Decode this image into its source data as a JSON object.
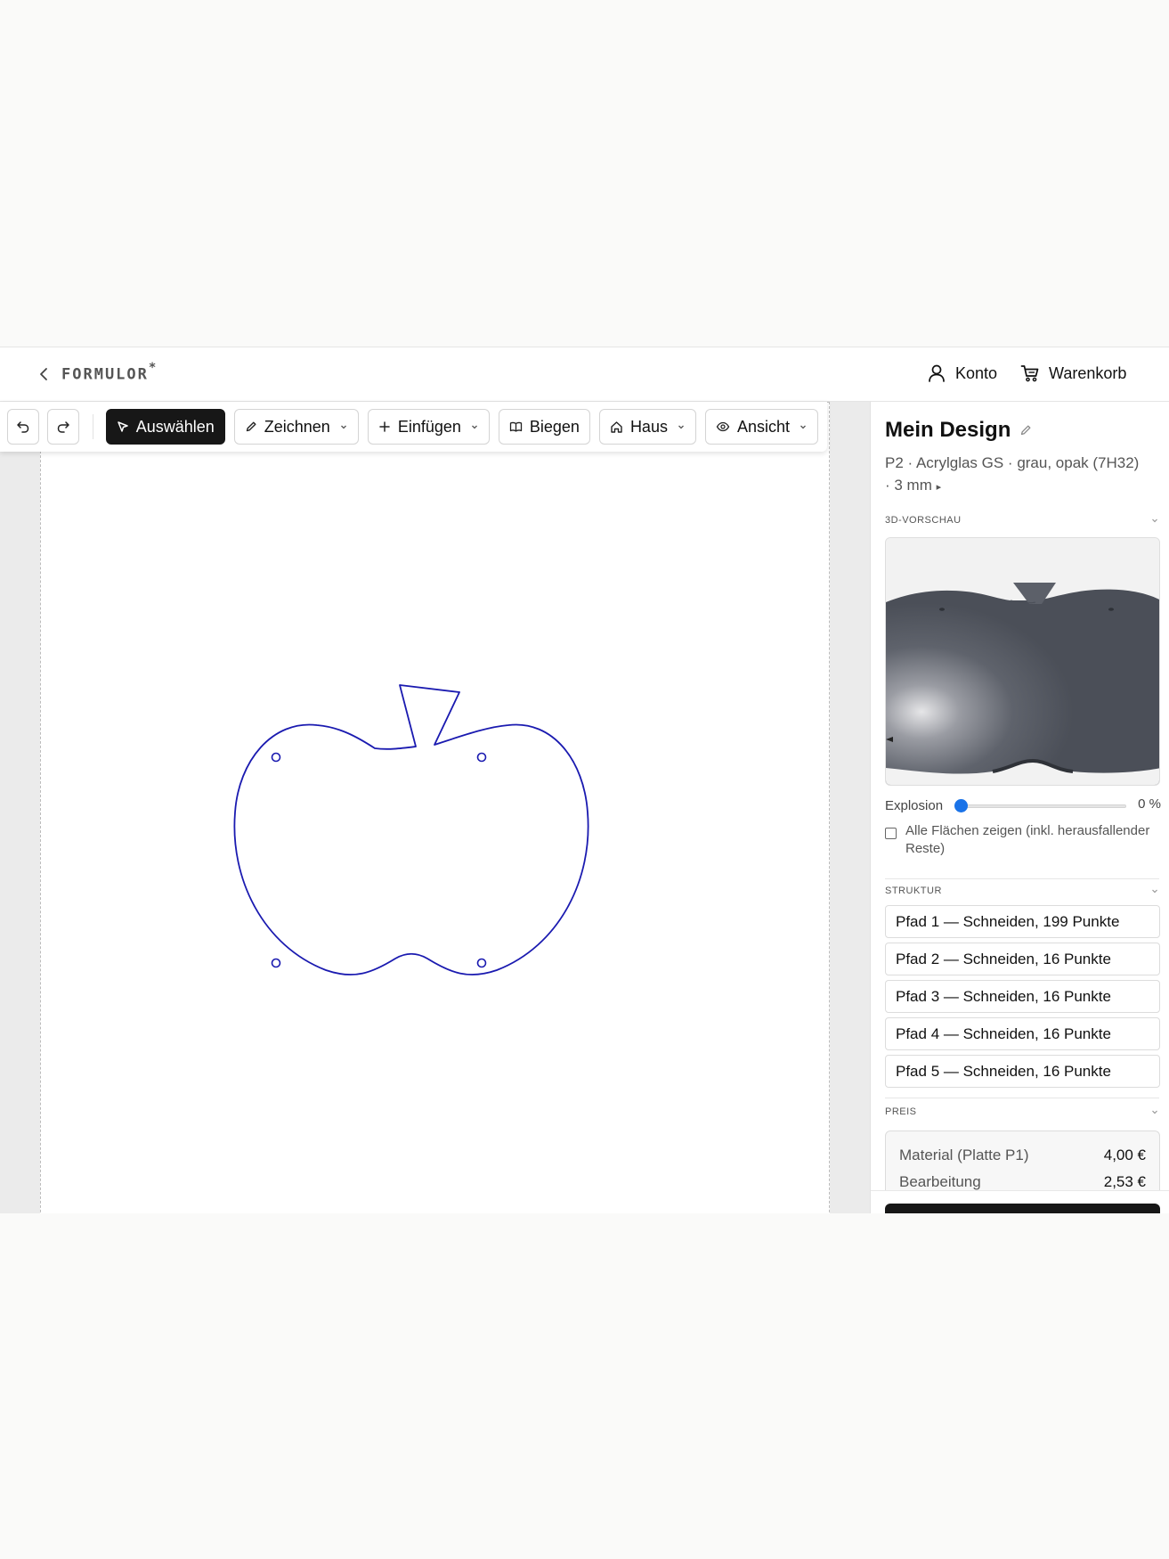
{
  "header": {
    "logo_text": "FORMULOR",
    "logo_mark": "*",
    "account_label": "Konto",
    "cart_label": "Warenkorb"
  },
  "toolbar": {
    "select_label": "Auswählen",
    "draw_label": "Zeichnen",
    "insert_label": "Einfügen",
    "bend_label": "Biegen",
    "house_label": "Haus",
    "view_label": "Ansicht"
  },
  "panel": {
    "title": "Mein Design",
    "material_line1": "P2 · Acrylglas GS · grau, opak (7H32)",
    "material_line2": "· 3 mm",
    "material_toggle": "▸",
    "preview_heading": "3D-VORSCHAU",
    "explosion_label": "Explosion",
    "explosion_value": "0 %",
    "explosion_level": 0,
    "show_all_label": "Alle Flächen zeigen (inkl. herausfallender Reste)",
    "structure_heading": "STRUKTUR",
    "paths": [
      "Pfad 1 — Schneiden, 199 Punkte",
      "Pfad 2 — Schneiden, 16 Punkte",
      "Pfad 3 — Schneiden, 16 Punkte",
      "Pfad 4 — Schneiden, 16 Punkte",
      "Pfad 5 — Schneiden, 16 Punkte"
    ],
    "price_heading": "PREIS",
    "price_rows": [
      {
        "label": "Material (Platte P1)",
        "amount": "4,00 €"
      },
      {
        "label": "Bearbeitung",
        "amount": "2,53 €"
      }
    ]
  },
  "colors": {
    "cut_line": "#1a1ab0",
    "accent": "#1a73e8",
    "active_button": "#171717"
  }
}
